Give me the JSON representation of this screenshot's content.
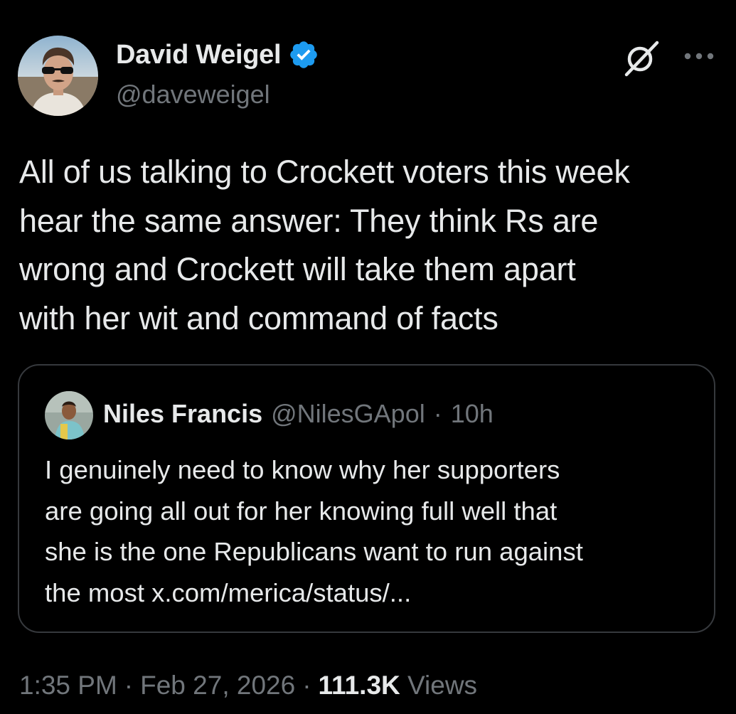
{
  "author": {
    "name": "David Weigel",
    "handle": "@daveweigel",
    "verified": true,
    "verified_color": "#1d9bf0"
  },
  "tweet": {
    "text": "All of us talking to Crockett voters this week\nhear the same answer: They think Rs are\nwrong and Crockett will take them apart\nwith her wit and command of facts"
  },
  "quoted_tweet": {
    "author_name": "Niles Francis",
    "author_handle": "@NilesGApol",
    "separator": "·",
    "time": "10h",
    "text": "I genuinely need to know why her supporters\nare going all out for her knowing full well that\nshe is the one Republicans want to run against\nthe most x.com/merica/status/..."
  },
  "meta": {
    "time": "1:35 PM",
    "sep1": "·",
    "date": "Feb 27, 2026",
    "sep2": "·",
    "views_count": "111.3K",
    "views_label": "Views"
  },
  "icons": {
    "grok": "grok-icon",
    "more": "more-icon",
    "verified": "verified-badge-icon"
  },
  "colors": {
    "background": "#000000",
    "text_primary": "#e7e9ea",
    "text_secondary": "#71767b",
    "border": "#36393d",
    "accent": "#1d9bf0"
  }
}
